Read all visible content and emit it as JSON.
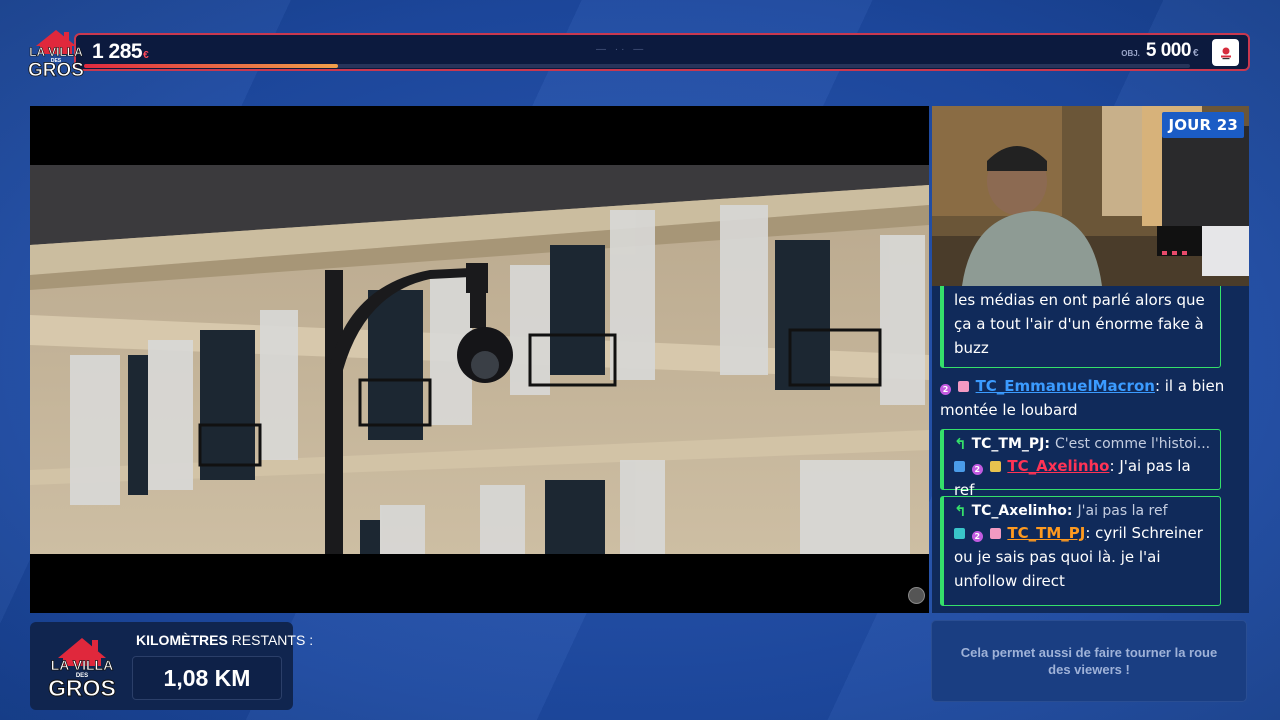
{
  "brand": {
    "logo_text_1": "LA VILLA",
    "logo_text_2": "DES",
    "logo_text_3": "GROS"
  },
  "progress": {
    "current_value": "1 285",
    "current_unit": "€",
    "objective_label": "OBJ.",
    "objective_value": "5 000",
    "objective_unit": "€",
    "fill_fraction": 0.23,
    "center_mark": "— ·· —",
    "accent_color": "#c9384f"
  },
  "webcam": {
    "day_label": "JOUR 23"
  },
  "chat": {
    "messages": [
      {
        "text": "les médias en ont parlé alors que ça a tout l'air d'un énorme fake à buzz"
      },
      {
        "user": "TC_EmmanuelMacron",
        "text": ": il a bien montée le loubard"
      },
      {
        "reply_user": "TC_TM_PJ:",
        "reply_text": "C'est comme l'histoi...",
        "user": "TC_Axelinho",
        "text": ": J'ai pas la ref"
      },
      {
        "reply_user": "TC_Axelinho:",
        "reply_text": "J'ai pas la ref",
        "user": "TC_TM_PJ",
        "text": ": cyril Schreiner ou je sais pas quoi là. je l'ai unfollow direct"
      }
    ],
    "sub_badge": "2"
  },
  "km": {
    "title_bold": "KILOMÈTRES",
    "title_rest": " RESTANTS :",
    "value": "1,08 KM"
  },
  "info": {
    "text": "Cela permet aussi de faire tourner la roue des viewers !"
  }
}
